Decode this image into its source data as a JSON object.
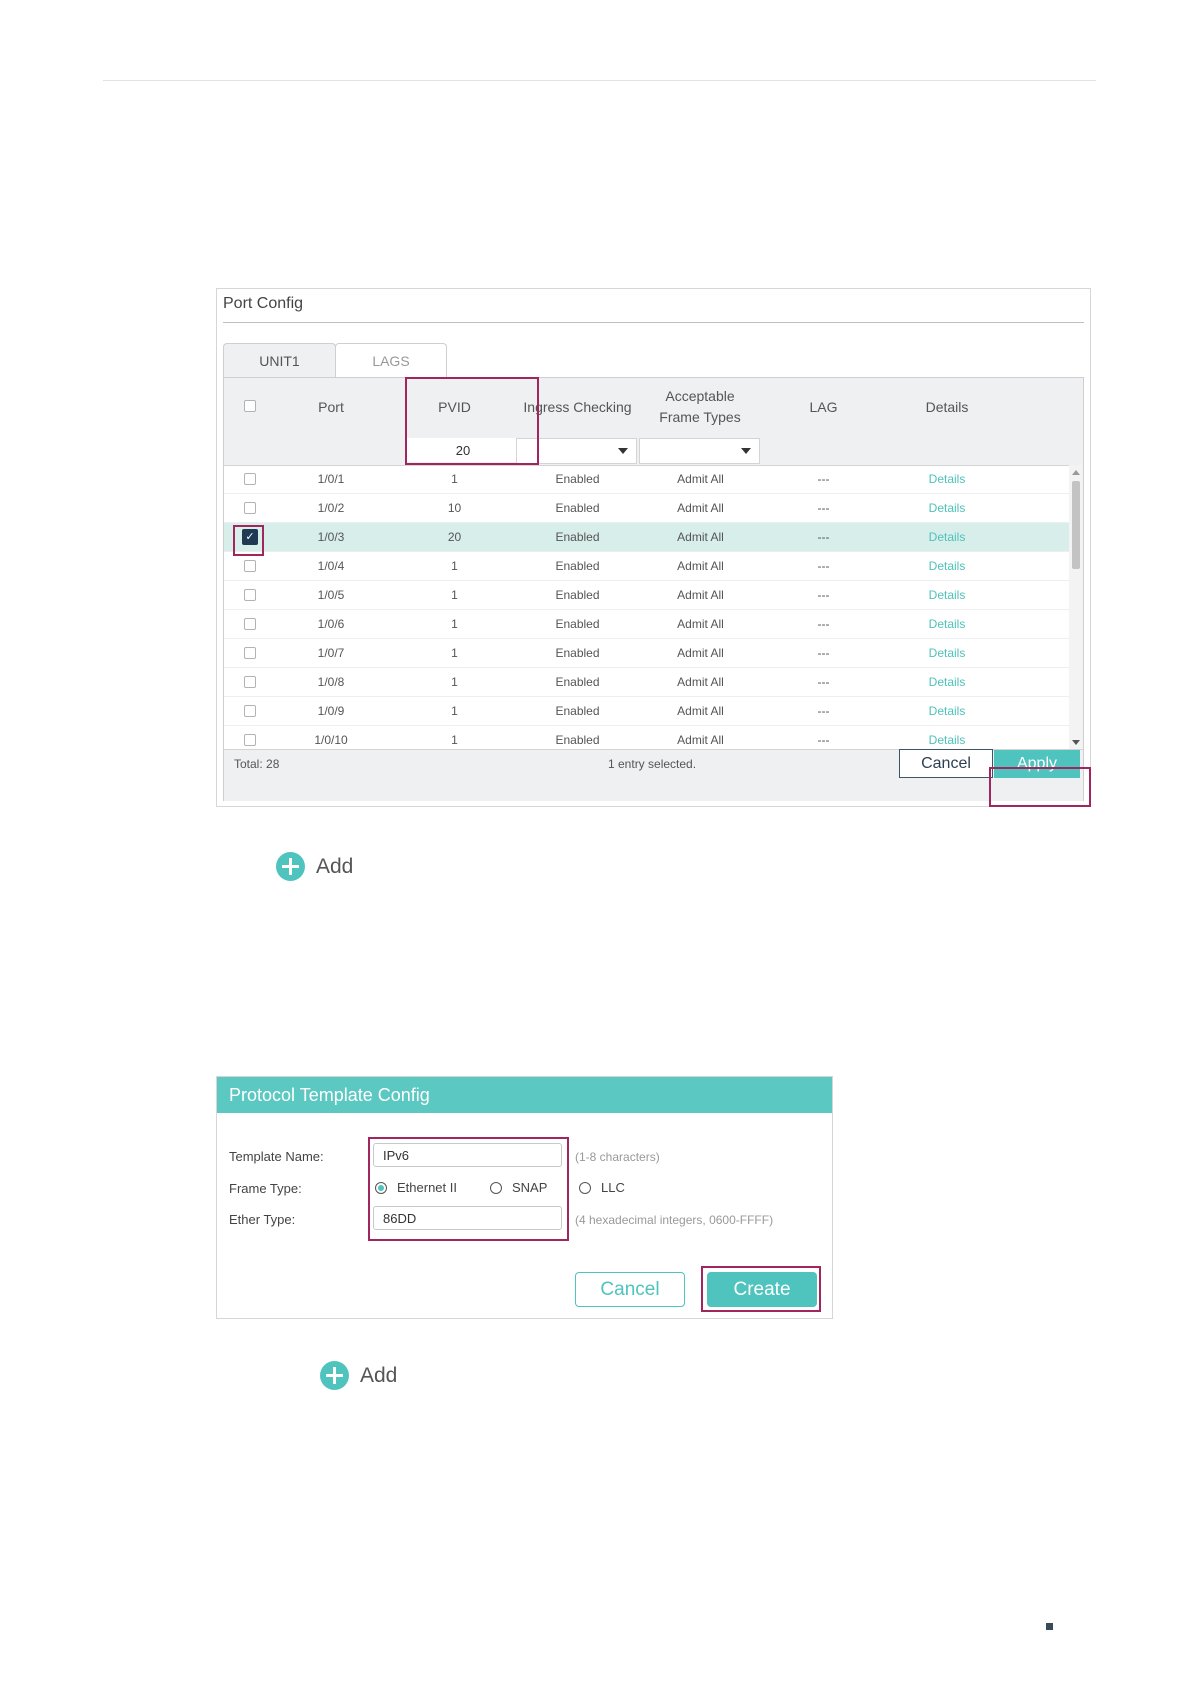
{
  "port_config": {
    "title": "Port Config",
    "tabs": [
      "UNIT1",
      "LAGS"
    ],
    "columns": [
      "Port",
      "PVID",
      "Ingress Checking",
      "Acceptable Frame Types",
      "LAG",
      "Details"
    ],
    "filter": {
      "pvid_value": "20"
    },
    "rows": [
      {
        "checked": false,
        "port": "1/0/1",
        "pvid": "1",
        "ingress": "Enabled",
        "frame_types": "Admit All",
        "lag": "---",
        "details": "Details"
      },
      {
        "checked": false,
        "port": "1/0/2",
        "pvid": "10",
        "ingress": "Enabled",
        "frame_types": "Admit All",
        "lag": "---",
        "details": "Details"
      },
      {
        "checked": true,
        "port": "1/0/3",
        "pvid": "20",
        "ingress": "Enabled",
        "frame_types": "Admit All",
        "lag": "---",
        "details": "Details"
      },
      {
        "checked": false,
        "port": "1/0/4",
        "pvid": "1",
        "ingress": "Enabled",
        "frame_types": "Admit All",
        "lag": "---",
        "details": "Details"
      },
      {
        "checked": false,
        "port": "1/0/5",
        "pvid": "1",
        "ingress": "Enabled",
        "frame_types": "Admit All",
        "lag": "---",
        "details": "Details"
      },
      {
        "checked": false,
        "port": "1/0/6",
        "pvid": "1",
        "ingress": "Enabled",
        "frame_types": "Admit All",
        "lag": "---",
        "details": "Details"
      },
      {
        "checked": false,
        "port": "1/0/7",
        "pvid": "1",
        "ingress": "Enabled",
        "frame_types": "Admit All",
        "lag": "---",
        "details": "Details"
      },
      {
        "checked": false,
        "port": "1/0/8",
        "pvid": "1",
        "ingress": "Enabled",
        "frame_types": "Admit All",
        "lag": "---",
        "details": "Details"
      },
      {
        "checked": false,
        "port": "1/0/9",
        "pvid": "1",
        "ingress": "Enabled",
        "frame_types": "Admit All",
        "lag": "---",
        "details": "Details"
      },
      {
        "checked": false,
        "port": "1/0/10",
        "pvid": "1",
        "ingress": "Enabled",
        "frame_types": "Admit All",
        "lag": "---",
        "details": "Details"
      }
    ],
    "footer": {
      "total": "Total: 28",
      "selected": "1 entry selected."
    },
    "buttons": {
      "cancel": "Cancel",
      "apply": "Apply"
    }
  },
  "add_button_1": {
    "label": "Add"
  },
  "protocol_template": {
    "title": "Protocol Template Config",
    "template_name_label": "Template Name:",
    "template_name_value": "IPv6",
    "template_name_hint": "(1-8 characters)",
    "frame_type_label": "Frame Type:",
    "frame_type_options": [
      "Ethernet II",
      "SNAP",
      "LLC"
    ],
    "frame_type_selected": "Ethernet II",
    "ether_type_label": "Ether Type:",
    "ether_type_value": "86DD",
    "ether_type_hint": "(4 hexadecimal integers, 0600-FFFF)",
    "buttons": {
      "cancel": "Cancel",
      "create": "Create"
    }
  },
  "add_button_2": {
    "label": "Add"
  },
  "colors": {
    "accent": "#4fc3bd",
    "highlight": "#a1265e",
    "selected_row": "#d8eeea",
    "dark_button": "#1f3a52"
  },
  "icons": {
    "add": "plus-circle-icon",
    "checkbox_checked": "checkmark-icon",
    "dropdown": "caret-down-icon"
  }
}
